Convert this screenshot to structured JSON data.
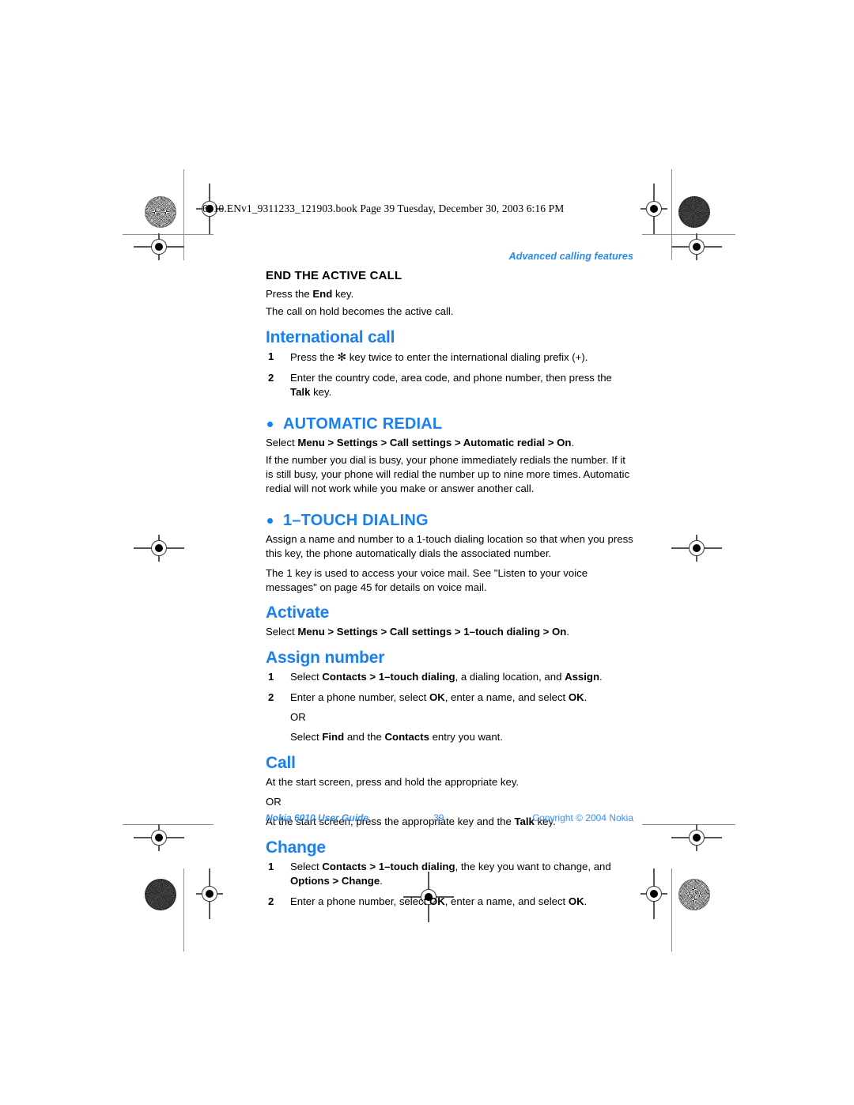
{
  "print_marks": {
    "filename_line": "6010.ENv1_9311233_121903.book  Page 39  Tuesday, December 30, 2003  6:16 PM"
  },
  "page": {
    "running_head": "Advanced calling features",
    "footer": {
      "left": "Nokia 6010 User Guide",
      "page_number": "39",
      "right": "Copyright © 2004 Nokia"
    },
    "sections": [
      {
        "id": "end-the-active-call",
        "heading": "END THE ACTIVE CALL",
        "paragraphs": [
          "Press the End key.",
          "The call on hold becomes the active call."
        ]
      },
      {
        "id": "international-call",
        "heading": "International call",
        "steps": [
          {
            "num": "1",
            "text": "Press the ✻ key twice to enter the international dialing prefix (+)."
          },
          {
            "num": "2",
            "text": "Enter the country code, area code, and phone number, then press the Talk key."
          }
        ]
      },
      {
        "id": "automatic-redial",
        "heading": "AUTOMATIC REDIAL",
        "menu_path": "Select Menu > Settings > Call settings > Automatic redial > On.",
        "paragraphs": [
          "If the number you dial is busy, your phone immediately redials the number. If it is still busy, your phone will redial the number up to nine more times. Automatic redial will not work while you make or answer another call."
        ]
      },
      {
        "id": "1-touch-dialing",
        "heading": "1–TOUCH DIALING",
        "paragraphs": [
          "Assign a name and number to a 1-touch dialing location so that when you press this key, the phone automatically dials the associated number.",
          "The 1 key is used to access your voice mail. See \"Listen to your voice messages\" on page 45 for details on voice mail."
        ]
      },
      {
        "id": "activate",
        "heading": "Activate",
        "menu_path": "Select Menu > Settings > Call settings > 1–touch dialing > On."
      },
      {
        "id": "assign-number",
        "heading": "Assign number",
        "steps": [
          {
            "num": "1",
            "text": "Select Contacts > 1–touch dialing, a dialing location, and Assign."
          },
          {
            "num": "2",
            "text": "Enter a phone number, select OK, enter a name, and select OK.",
            "or_label": "OR",
            "alt_text": "Select Find and the Contacts entry you want."
          }
        ]
      },
      {
        "id": "call",
        "heading": "Call",
        "paragraphs": [
          "At the start screen, press and hold the appropriate key.",
          "OR",
          "At the start screen, press the appropriate key and the Talk key."
        ]
      },
      {
        "id": "change",
        "heading": "Change",
        "steps": [
          {
            "num": "1",
            "text": "Select Contacts > 1–touch dialing, the key you want to change, and Options > Change."
          },
          {
            "num": "2",
            "text": "Enter a phone number, select OK, enter a name, and select OK."
          }
        ]
      }
    ]
  },
  "colors": {
    "heading_blue": "#1a80ef",
    "footer_blue": "#3a8ef0",
    "running_head_blue": "#2b87ef",
    "body_black": "#000000"
  }
}
